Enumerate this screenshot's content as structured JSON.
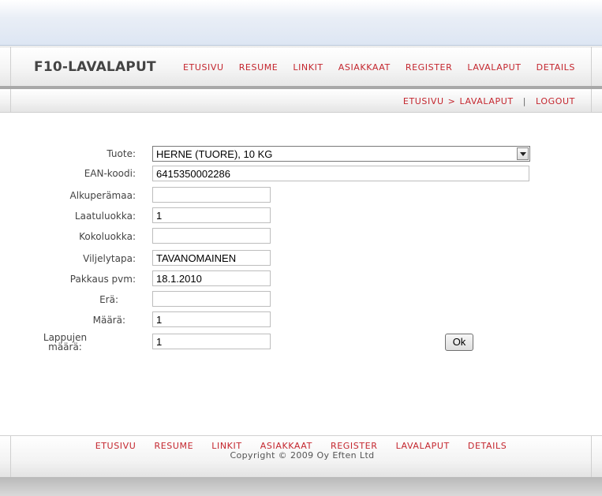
{
  "header": {
    "title": "F10-LAVALAPUT",
    "nav": [
      "ETUSIVU",
      "RESUME",
      "LINKIT",
      "ASIAKKAAT",
      "REGISTER",
      "LAVALAPUT",
      "DETAILS"
    ]
  },
  "breadcrumb": {
    "home": "ETUSIVU",
    "separator": ">",
    "current": "LAVALAPUT",
    "divider": "|",
    "logout": "LOGOUT"
  },
  "form": {
    "tuote_label": "Tuote:",
    "tuote_value": "HERNE (TUORE), 10 KG",
    "ean_label": "EAN-koodi:",
    "ean_value": "6415350002286",
    "alkuperamaa_label": "Alkuperämaa:",
    "alkuperamaa_value": "",
    "laatuluokka_label": "Laatuluokka:",
    "laatuluokka_value": "1",
    "kokoluokka_label": "Kokoluokka:",
    "kokoluokka_value": "",
    "viljelytapa_label": "Viljelytapa:",
    "viljelytapa_value": "TAVANOMAINEN",
    "pakkaus_label": "Pakkaus pvm:",
    "pakkaus_value": "18.1.2010",
    "era_label": "Erä:",
    "era_value": "",
    "maara_label": "Määrä:",
    "maara_value": "1",
    "lappujen_label_line1": "Lappujen",
    "lappujen_label_line2": "määrä:",
    "lappujen_value": "1",
    "ok_label": "Ok"
  },
  "footer": {
    "nav": [
      "ETUSIVU",
      "RESUME",
      "LINKIT",
      "ASIAKKAAT",
      "REGISTER",
      "LAVALAPUT",
      "DETAILS"
    ],
    "copyright": "Copyright © 2009 Oy Eften Ltd"
  },
  "colors": {
    "link": "#c4262e",
    "header_divider": "#a8a8a8"
  }
}
